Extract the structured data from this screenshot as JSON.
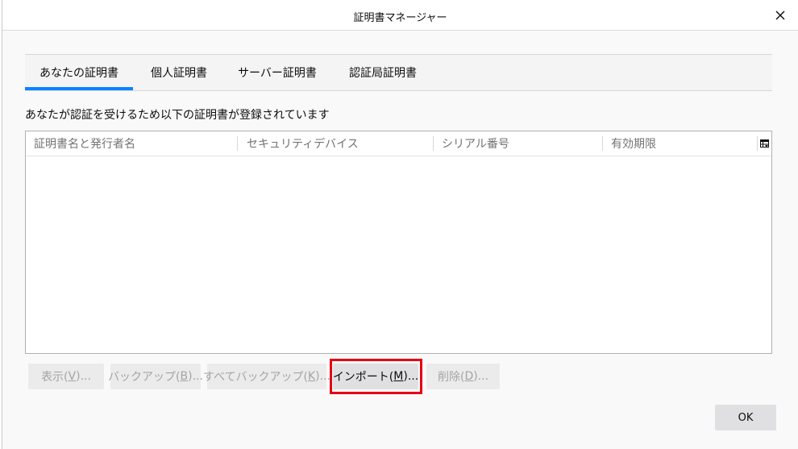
{
  "window": {
    "title": "証明書マネージャー",
    "close_icon": "close-icon"
  },
  "tabs": [
    {
      "label": "あなたの証明書",
      "selected": true
    },
    {
      "label": "個人証明書",
      "selected": false
    },
    {
      "label": "サーバー証明書",
      "selected": false
    },
    {
      "label": "認証局証明書",
      "selected": false
    }
  ],
  "description": "あなたが認証を受けるため以下の証明書が登録されています",
  "table": {
    "columns": [
      "証明書名と発行者名",
      "セキュリティデバイス",
      "シリアル番号",
      "有効期限"
    ],
    "column_picker_icon": "column-picker-icon",
    "rows": []
  },
  "buttons": [
    {
      "label": "表示(V)...",
      "accesskey": "V",
      "enabled": false
    },
    {
      "label": "バックアップ(B)...",
      "accesskey": "B",
      "enabled": false
    },
    {
      "label": "すべてバックアップ(K)...",
      "accesskey": "K",
      "enabled": false
    },
    {
      "label": "インポート(M)...",
      "accesskey": "M",
      "enabled": true,
      "highlighted": true
    },
    {
      "label": "削除(D)...",
      "accesskey": "D",
      "enabled": false
    }
  ],
  "ok_button": {
    "label": "OK",
    "enabled": true
  },
  "colors": {
    "accent": "#0a84ff",
    "highlight": "#e60012"
  }
}
